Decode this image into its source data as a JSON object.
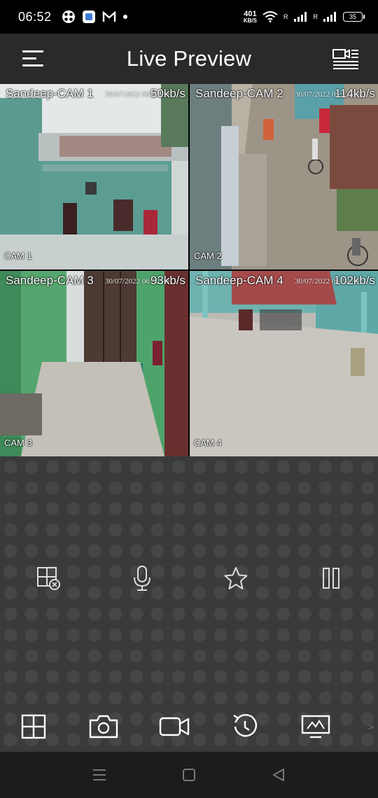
{
  "status_bar": {
    "time": "06:52",
    "net_speed_value": "401",
    "net_speed_unit": "KB/S",
    "signal_label_1": "R",
    "signal_label_2": "R",
    "battery_level": "35",
    "notification_icons": [
      "app-icon",
      "files-icon",
      "gmail-icon",
      "dot-icon"
    ]
  },
  "header": {
    "title": "Live Preview"
  },
  "cameras": [
    {
      "name": "Sandeep-CAM 1",
      "bitrate": "50kb/s",
      "timestamp": "30/07/2022 06:52:30",
      "channel_label": "CAM 1",
      "selected": true
    },
    {
      "name": "Sandeep-CAM 2",
      "bitrate": "114kb/s",
      "timestamp": "30/07/2022 06:52:30",
      "channel_label": "CAM 2",
      "selected": false
    },
    {
      "name": "Sandeep-CAM 3",
      "bitrate": "93kb/s",
      "timestamp": "30/07/2022 06:52:30",
      "channel_label": "CAM 3",
      "selected": false
    },
    {
      "name": "Sandeep-CAM 4",
      "bitrate": "102kb/s",
      "timestamp": "30/07/2022 06:52:30",
      "channel_label": "CAM 4",
      "selected": false
    }
  ],
  "controls_row1": [
    "close-window-icon",
    "microphone-icon",
    "star-icon",
    "pause-icon"
  ],
  "controls_row2": [
    "grid-layout-icon",
    "camera-icon",
    "video-record-icon",
    "playback-icon",
    "display-icon"
  ],
  "more_indicator": ">",
  "accent_color": "#c8283a"
}
